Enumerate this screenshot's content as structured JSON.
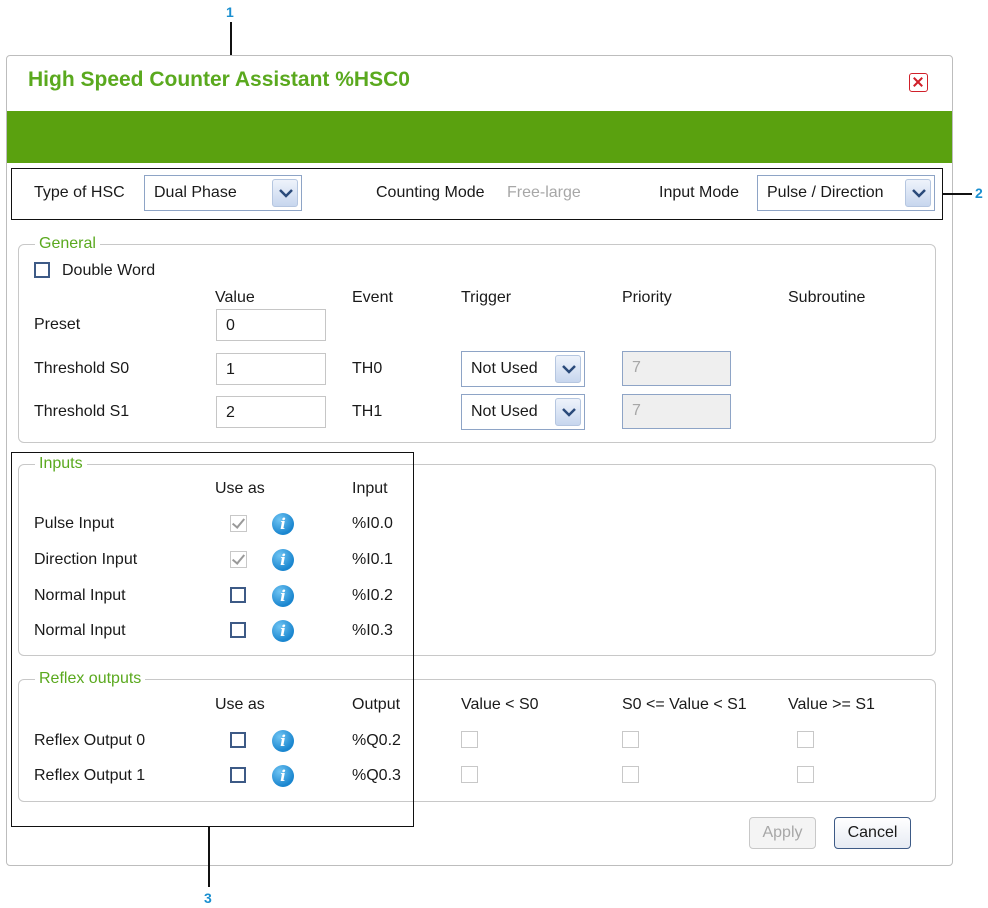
{
  "callouts": [
    "1",
    "2",
    "3"
  ],
  "dialog": {
    "title": "High Speed Counter Assistant %HSC0"
  },
  "colors": {
    "title": "#5aa91e",
    "banner": "#5aa10f",
    "callout": "#1a8fd0",
    "close": "#d0202a"
  },
  "config": {
    "type_label": "Type of HSC",
    "type_value": "Dual Phase",
    "counting_mode_label": "Counting Mode",
    "counting_mode_value": "Free-large",
    "input_mode_label": "Input Mode",
    "input_mode_value": "Pulse / Direction"
  },
  "general": {
    "legend": "General",
    "double_word_label": "Double Word",
    "double_word_checked": false,
    "headers": {
      "value": "Value",
      "event": "Event",
      "trigger": "Trigger",
      "priority": "Priority",
      "subroutine": "Subroutine"
    },
    "rows": [
      {
        "label": "Preset",
        "value": "0"
      },
      {
        "label": "Threshold S0",
        "value": "1",
        "event": "TH0",
        "trigger": "Not Used",
        "priority": "7"
      },
      {
        "label": "Threshold S1",
        "value": "2",
        "event": "TH1",
        "trigger": "Not Used",
        "priority": "7"
      }
    ]
  },
  "inputs": {
    "legend": "Inputs",
    "headers": {
      "use_as": "Use as",
      "input": "Input"
    },
    "rows": [
      {
        "label": "Pulse Input",
        "checked": true,
        "disabled": true,
        "address": "%I0.0"
      },
      {
        "label": "Direction Input",
        "checked": true,
        "disabled": true,
        "address": "%I0.1"
      },
      {
        "label": "Normal Input",
        "checked": false,
        "disabled": false,
        "address": "%I0.2"
      },
      {
        "label": "Normal Input",
        "checked": false,
        "disabled": false,
        "address": "%I0.3"
      }
    ]
  },
  "reflex": {
    "legend": "Reflex outputs",
    "headers": {
      "use_as": "Use as",
      "output": "Output",
      "lt_s0": "Value < S0",
      "between": "S0 <= Value < S1",
      "ge_s1": "Value >= S1"
    },
    "rows": [
      {
        "label": "Reflex Output 0",
        "address": "%Q0.2"
      },
      {
        "label": "Reflex Output 1",
        "address": "%Q0.3"
      }
    ]
  },
  "buttons": {
    "apply": "Apply",
    "cancel": "Cancel"
  },
  "icons": {
    "info": "i",
    "close": "close-icon",
    "dropdown": "chevron-down-icon"
  }
}
